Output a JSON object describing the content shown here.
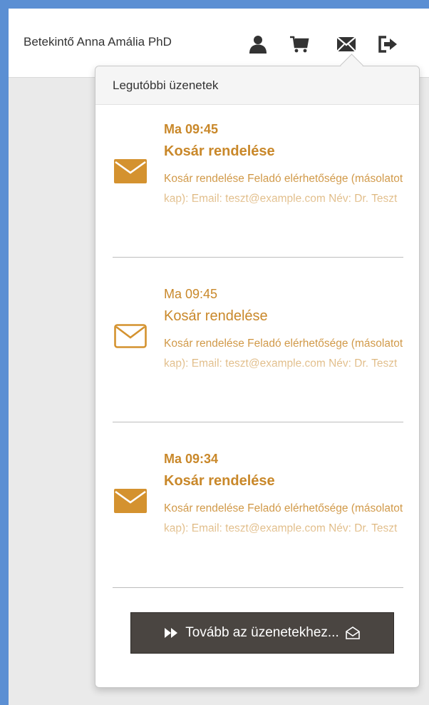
{
  "navbar": {
    "user_name": "Betekintő Anna Amália PhD",
    "icons": [
      "user-icon",
      "cart-icon",
      "envelope-icon",
      "logout-icon"
    ]
  },
  "dropdown": {
    "header": "Legutóbbi üzenetek",
    "messages": [
      {
        "time": "Ma 09:45",
        "title": "Kosár rendelése",
        "preview": "Kosár rendelése Feladó elérhetősége (másolatot kap): Email: teszt@example.com Név: Dr. Teszt",
        "unread": true
      },
      {
        "time": "Ma 09:45",
        "title": "Kosár rendelése",
        "preview": "Kosár rendelése Feladó elérhetősége (másolatot kap): Email: teszt@example.com Név: Dr. Teszt",
        "unread": false
      },
      {
        "time": "Ma 09:34",
        "title": "Kosár rendelése",
        "preview": "Kosár rendelése Feladó elérhetősége (másolatot kap): Email: teszt@example.com Név: Dr. Teszt",
        "unread": true
      }
    ],
    "more_button_label": "Tovább az üzenetekhez..."
  },
  "colors": {
    "accent": "#c9882a",
    "border_frame": "#5b8fd3",
    "button_bg": "#4a4541"
  }
}
